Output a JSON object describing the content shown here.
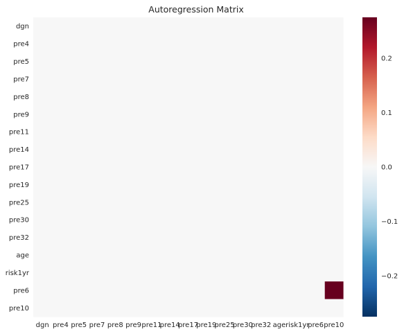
{
  "chart_data": {
    "type": "heatmap",
    "title": "Autoregression Matrix",
    "xlabel": "",
    "ylabel": "",
    "row_labels": [
      "dgn",
      "pre4",
      "pre5",
      "pre7",
      "pre8",
      "pre9",
      "pre11",
      "pre14",
      "pre17",
      "pre19",
      "pre25",
      "pre30",
      "pre32",
      "age",
      "risk1yr",
      "pre6",
      "pre10"
    ],
    "col_labels": [
      "dgn",
      "pre4",
      "pre5",
      "pre7",
      "pre8",
      "pre9",
      "pre11",
      "pre14",
      "pre17",
      "pre19",
      "pre25",
      "pre30",
      "pre32",
      "age",
      "risk1yr",
      "pre6",
      "pre10"
    ],
    "nonzero_cells": [
      {
        "row": "pre6",
        "col": "pre10",
        "value": 0.275
      }
    ],
    "default_value": 0,
    "colormap": "RdBu_r",
    "colorbar": {
      "vmin": -0.275,
      "vmax": 0.275,
      "ticks": [
        -0.2,
        -0.1,
        0.0,
        0.1,
        0.2
      ],
      "tick_labels": [
        "−0.2",
        "−0.1",
        "0.0",
        "0.1",
        "0.2"
      ]
    },
    "colorbar_stops": [
      "#053061",
      "#2166ac",
      "#4393c3",
      "#92c5de",
      "#d1e5f0",
      "#f7f7f7",
      "#fddbc7",
      "#f4a582",
      "#d6604d",
      "#b2182b",
      "#67001f"
    ]
  }
}
